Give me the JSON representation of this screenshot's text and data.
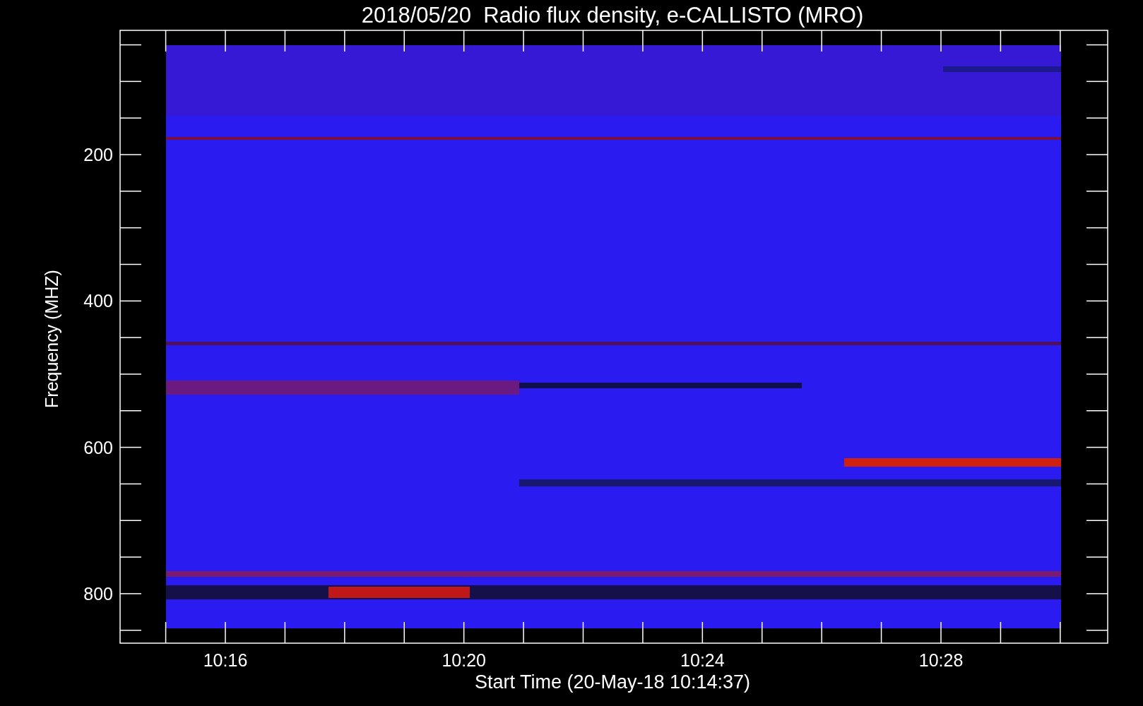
{
  "title": "2018/05/20  Radio flux density, e-CALLISTO (MRO)",
  "ylabel": "Frequency (MHZ)",
  "xlabel": "Start Time (20-May-18 10:14:37)",
  "yticks": [
    "200",
    "400",
    "600",
    "800"
  ],
  "xticks": [
    "10:16",
    "10:20",
    "10:24",
    "10:28"
  ]
}
